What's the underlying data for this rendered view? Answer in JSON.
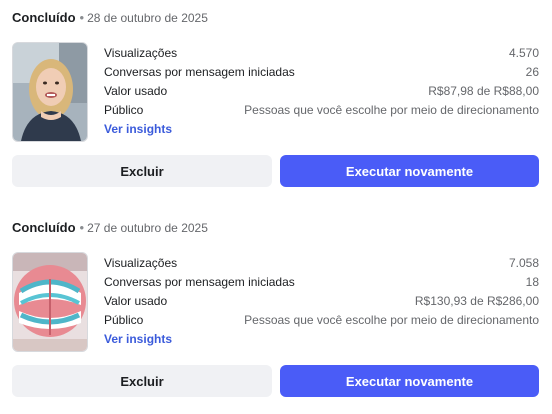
{
  "cards": [
    {
      "status": "Concluído",
      "separator": "•",
      "date": "28 de outubro de 2025",
      "thumbnail_icon": "video-thumbnail-woman-selfie",
      "metrics": [
        {
          "label": "Visualizações",
          "value": "4.570"
        },
        {
          "label": "Conversas por mensagem iniciadas",
          "value": "26"
        },
        {
          "label": "Valor usado",
          "value": "R$87,98 de R$88,00"
        },
        {
          "label": "Público",
          "value": "Pessoas que você escolhe por meio de direcionamento"
        }
      ],
      "insights_link": "Ver insights",
      "delete_label": "Excluir",
      "rerun_label": "Executar novamente"
    },
    {
      "status": "Concluído",
      "separator": "•",
      "date": "27 de outubro de 2025",
      "thumbnail_icon": "video-thumbnail-dental-braces",
      "metrics": [
        {
          "label": "Visualizações",
          "value": "7.058"
        },
        {
          "label": "Conversas por mensagem iniciadas",
          "value": "18"
        },
        {
          "label": "Valor usado",
          "value": "R$130,93 de R$286,00"
        },
        {
          "label": "Público",
          "value": "Pessoas que você escolhe por meio de direcionamento"
        }
      ],
      "insights_link": "Ver insights",
      "delete_label": "Excluir",
      "rerun_label": "Executar novamente"
    }
  ],
  "colors": {
    "primary": "#4a5cf7",
    "secondary_button": "#f0f1f4",
    "link": "#3b5bdb"
  }
}
